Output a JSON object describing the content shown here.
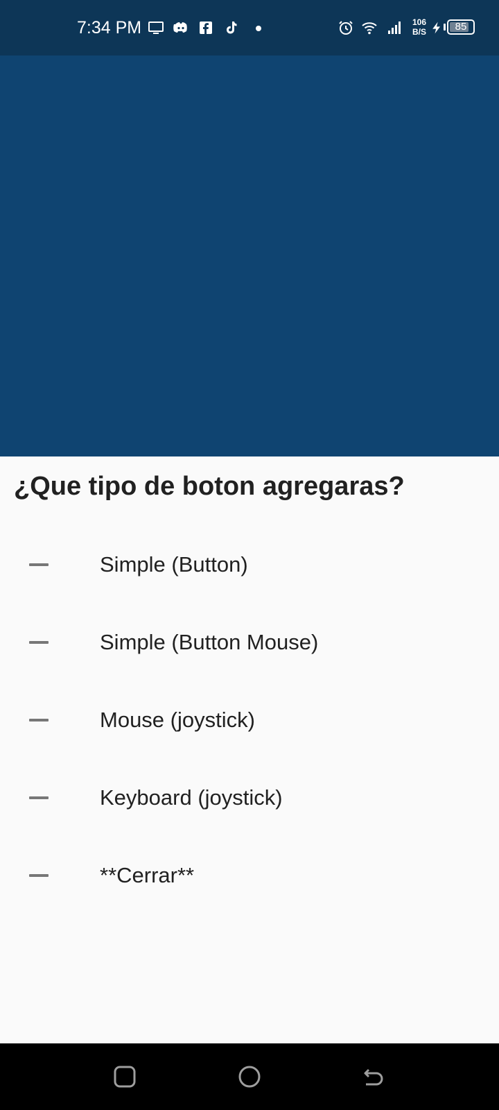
{
  "status_bar": {
    "time": "7:34 PM",
    "notification_icons": [
      "cast-screen-icon",
      "discord-icon",
      "facebook-icon",
      "tiktok-icon"
    ],
    "system_icons": [
      "alarm-icon",
      "wifi-icon",
      "signal-icon",
      "charging-icon"
    ],
    "net_speed_value": "106",
    "net_speed_unit": "B/S",
    "battery_level": "85",
    "battery_fraction": 0.85
  },
  "app": {
    "background_color": "#0f4471"
  },
  "sheet": {
    "title": "¿Que tipo de boton agregaras?",
    "options": [
      {
        "icon": "dash-icon",
        "label": "Simple (Button)"
      },
      {
        "icon": "dash-icon",
        "label": "Simple (Button Mouse)"
      },
      {
        "icon": "dash-icon",
        "label": "Mouse (joystick)"
      },
      {
        "icon": "dash-icon",
        "label": "Keyboard (joystick)"
      },
      {
        "icon": "dash-icon",
        "label": "**Cerrar**"
      }
    ]
  },
  "nav_bar": {
    "buttons": [
      "recents-icon",
      "home-icon",
      "back-icon"
    ]
  },
  "colors": {
    "status_bar": "#0d3657",
    "sheet_background": "#fafafa",
    "text": "#212121",
    "dash": "#777777",
    "nav_bar": "#000000"
  }
}
